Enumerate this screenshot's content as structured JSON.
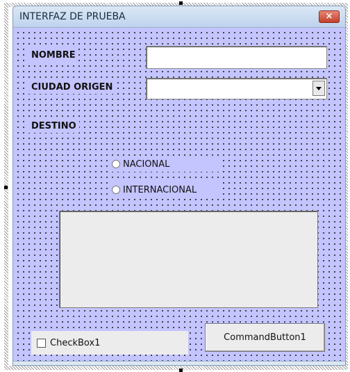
{
  "form": {
    "title": "INTERFAZ DE PRUEBA",
    "close_symbol": "×",
    "close_icon": "close-icon",
    "background_color": "#c4c4ff"
  },
  "fields": {
    "nombre_label": "NOMBRE",
    "nombre_value": "",
    "ciudad_origen_label": "CIUDAD ORIGEN",
    "ciudad_origen_value": "",
    "dropdown_icon": "chevron-down-icon",
    "destino_label": "DESTINO"
  },
  "destino_options": [
    {
      "label": "NACIONAL",
      "selected": false
    },
    {
      "label": "INTERNACIONAL",
      "selected": false
    }
  ],
  "checkbox": {
    "label": "CheckBox1",
    "checked": false
  },
  "command_button": {
    "label": "CommandButton1"
  }
}
